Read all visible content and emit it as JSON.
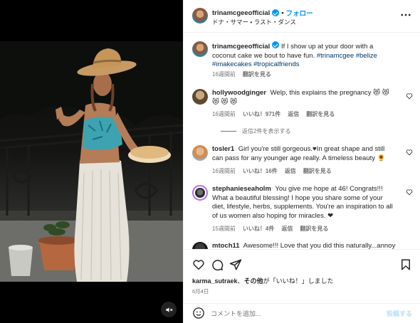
{
  "header": {
    "username": "trinamcgeeofficial",
    "separator": "•",
    "follow_label": "フォロー",
    "subtitle": "ドナ・サマー • ラスト・ダンス"
  },
  "caption": {
    "username": "trinamcgeeofficial",
    "text": "If I show up at your door with a coconut cake we bout to have fun.",
    "tags": "#trinamcgee #belize #imakecakes #tropicalfriends",
    "time": "16週間前",
    "translate": "翻訳を見る"
  },
  "comments": [
    {
      "username": "hollywoodginger",
      "text": "Welp, this explains the pregnancy 😻 😻 😻 😻 😻",
      "time": "16週間前",
      "likes": "いいね！971件",
      "reply": "返信",
      "translate": "翻訳を見る",
      "replies_label": "返信2件を表示する"
    },
    {
      "username": "tosler1",
      "text": "Girl you're still gorgeous.♥In great shape and still can pass for any younger age really. A timeless beauty 🌻",
      "time": "16週間前",
      "likes": "いいね！16件",
      "reply": "返信",
      "translate": "翻訳を見る"
    },
    {
      "username": "stephanieseaholm",
      "text": "You give me hope at 46! Congrats!!! What a beautiful blessing! I hope you share some of your diet, lifestyle, herbs, supplements. You're an inspiration to all of us women also hoping for miracles. ❤",
      "time": "15週間前",
      "likes": "いいね！4件",
      "reply": "返信",
      "translate": "翻訳を見る"
    },
    {
      "username": "mtoch11",
      "text": "Awesome!!! Love that you did this naturally...annoying"
    }
  ],
  "actions": {
    "liked_by_user": "karma_sutraek",
    "liked_by_others": "その他",
    "liked_by_suffix": "が「いいね！」しました",
    "date": "6月4日"
  },
  "composer": {
    "placeholder": "コメントを追加...",
    "post_label": "投稿する"
  },
  "colors": {
    "accent": "#0095f6",
    "text": "#262626",
    "secondary": "#737373",
    "border": "#efefef"
  }
}
